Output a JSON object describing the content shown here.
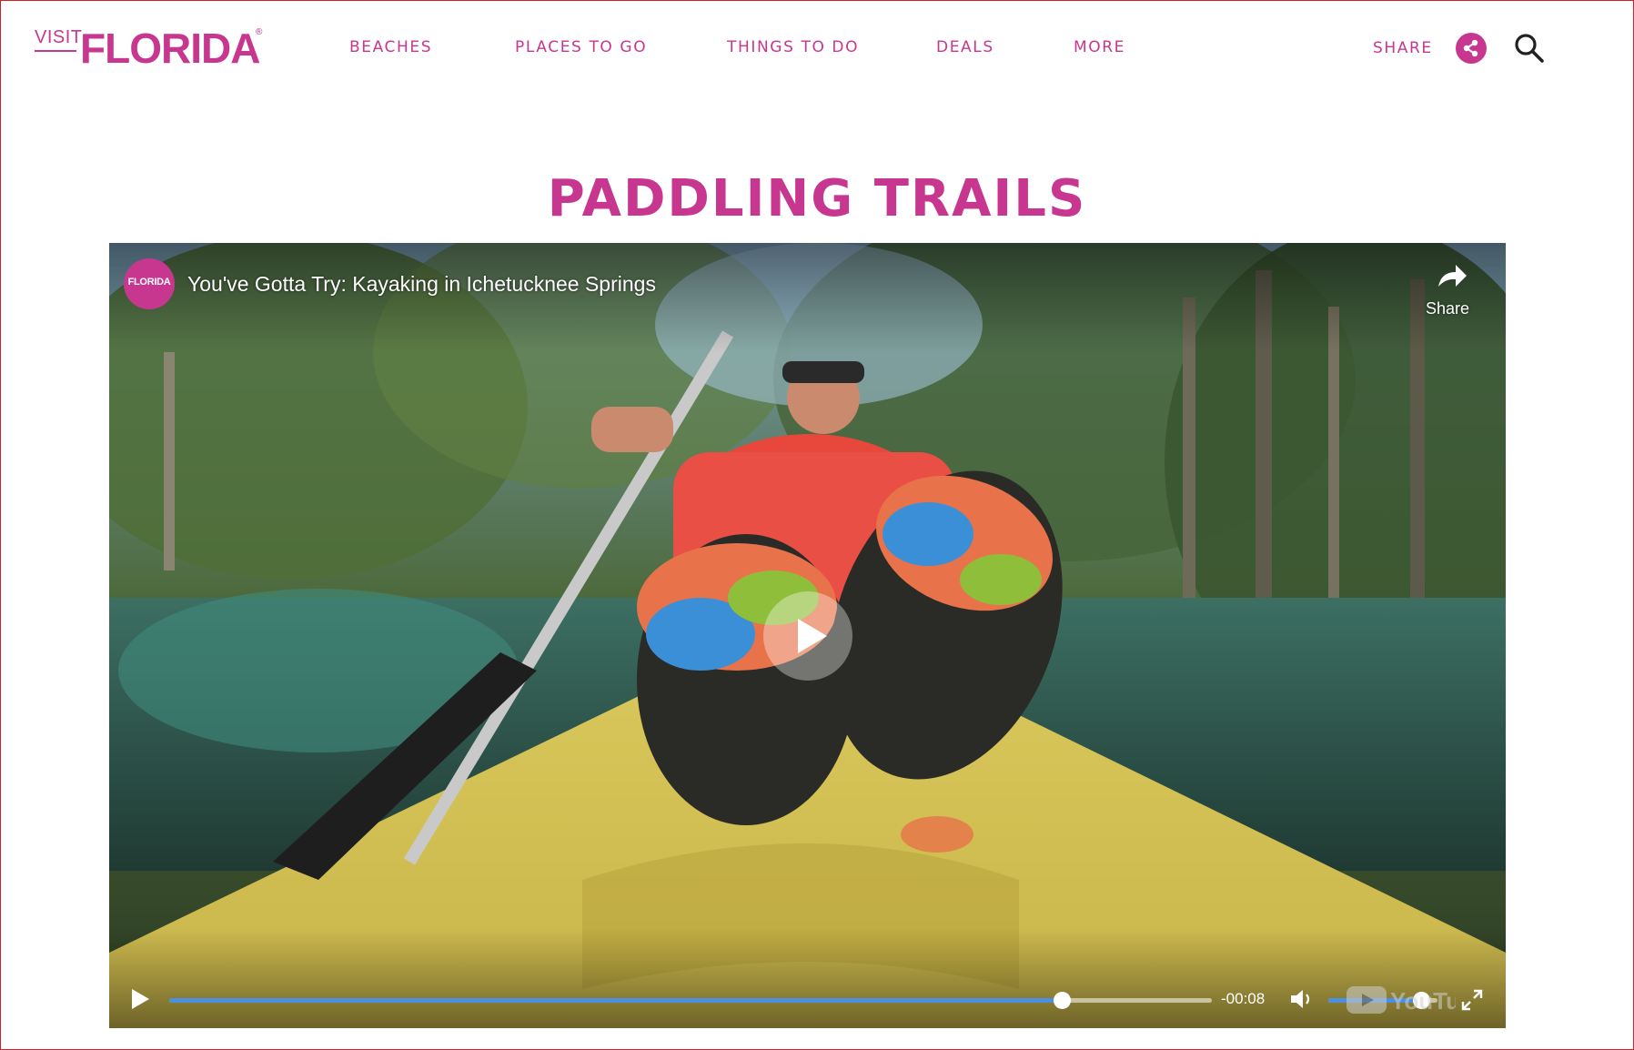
{
  "header": {
    "logo_visit": "VISIT",
    "logo_florida": "FLORIDA",
    "logo_reg": "®",
    "nav": [
      "BEACHES",
      "PLACES TO GO",
      "THINGS TO DO",
      "DEALS",
      "MORE"
    ],
    "share_label": "SHARE"
  },
  "page": {
    "title": "PADDLING TRAILS"
  },
  "video": {
    "channel": "FLORIDA",
    "title": "You've Gotta Try: Kayaking in Ichetucknee Springs",
    "share_label": "Share",
    "time_remaining": "-00:08",
    "progress_fraction": 0.856,
    "volume_fraction": 0.85,
    "watermark": "YouTube"
  },
  "colors": {
    "brand": "#c8378f",
    "progress": "#4a8fe0"
  },
  "icons": [
    "share-icon",
    "search-icon",
    "play-icon",
    "volume-icon",
    "fullscreen-icon"
  ]
}
